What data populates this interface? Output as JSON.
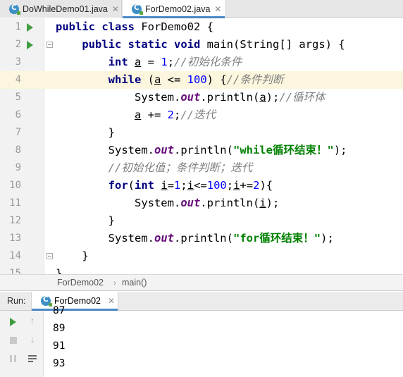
{
  "tabs": [
    {
      "label": "DoWhileDemo01.java",
      "active": false,
      "icon": "java-class-icon"
    },
    {
      "label": "ForDemo02.java",
      "active": true,
      "icon": "java-class-icon"
    }
  ],
  "editor": {
    "current_line": 4,
    "lines": [
      {
        "num": "1",
        "text": "public class ForDemo02 {",
        "run_icon": true,
        "fold_icon": false
      },
      {
        "num": "2",
        "text": "    public static void main(String[] args) {",
        "run_icon": true,
        "fold_icon": true
      },
      {
        "num": "3",
        "text": "        int a = 1;//初始化条件",
        "run_icon": false,
        "fold_icon": false
      },
      {
        "num": "4",
        "text": "        while (a <= 100) {//条件判断",
        "run_icon": false,
        "fold_icon": false
      },
      {
        "num": "5",
        "text": "            System.out.println(a);//循环体",
        "run_icon": false,
        "fold_icon": false
      },
      {
        "num": "6",
        "text": "            a += 2;//迭代",
        "run_icon": false,
        "fold_icon": false
      },
      {
        "num": "7",
        "text": "        }",
        "run_icon": false,
        "fold_icon": false
      },
      {
        "num": "8",
        "text": "        System.out.println(\"while循环结束！\");",
        "run_icon": false,
        "fold_icon": false
      },
      {
        "num": "9",
        "text": "        //初始化值；条件判断；迭代",
        "run_icon": false,
        "fold_icon": false
      },
      {
        "num": "10",
        "text": "        for(int i=1;i<=100;i+=2){",
        "run_icon": false,
        "fold_icon": false
      },
      {
        "num": "11",
        "text": "            System.out.println(i);",
        "run_icon": false,
        "fold_icon": false
      },
      {
        "num": "12",
        "text": "        }",
        "run_icon": false,
        "fold_icon": false
      },
      {
        "num": "13",
        "text": "        System.out.println(\"for循环结束！\");",
        "run_icon": false,
        "fold_icon": false
      },
      {
        "num": "14",
        "text": "    }",
        "run_icon": false,
        "fold_icon": true
      },
      {
        "num": "15",
        "text": "}",
        "run_icon": false,
        "fold_icon": false
      }
    ]
  },
  "breadcrumb": {
    "class_name": "ForDemo02",
    "separator": "›",
    "method_name": "main()"
  },
  "run_panel": {
    "label": "Run:",
    "tab_label": "ForDemo02",
    "toolbar_icons": [
      "rerun-icon",
      "scroll-up-icon",
      "stop-icon",
      "scroll-down-icon",
      "pause-icon",
      "soft-wrap-icon"
    ],
    "output": [
      "87",
      "89",
      "91",
      "93"
    ]
  },
  "colors": {
    "keyword": "#000080",
    "number": "#0000ff",
    "string": "#008000",
    "comment": "#808080",
    "static_field": "#660e7a",
    "current_line": "#fbf6dd",
    "run_green": "#3f9c3f",
    "tab_accent": "#4a88c7"
  }
}
